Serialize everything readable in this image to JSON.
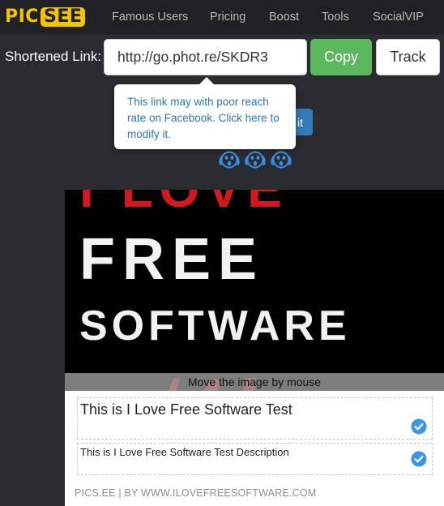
{
  "nav": {
    "logo_pic": "PIC",
    "logo_see": "SEE",
    "items": [
      {
        "label": "Famous Users"
      },
      {
        "label": "Pricing"
      },
      {
        "label": "Boost"
      },
      {
        "label": "Tools"
      },
      {
        "label": "SocialVIP"
      }
    ]
  },
  "shortener": {
    "label": "Shortened Link:",
    "url_value": "http://go.phot.re/SKDR3",
    "copy_label": "Copy",
    "track_label": "Track",
    "hidden_button_label": "it"
  },
  "tooltip": {
    "text": "This link may with poor reach rate on Facebook. Click here to modify it."
  },
  "emojis": [
    "scream-emoji-icon",
    "scream-emoji-icon",
    "scream-emoji-icon"
  ],
  "preview": {
    "image_line1": "I LOVE",
    "image_line2": "FREE",
    "image_line3": "SOFTWARE",
    "move_hint": "Move the image by mouse",
    "title_value": "This is I Love Free Software Test",
    "description_value": "This is I Love Free Software Test Description",
    "footer": "PICS.EE | BY WWW.ILOVEFREESOFTWARE.COM"
  },
  "colors": {
    "brand_yellow": "#f5c400",
    "copy_green": "#5cb85c",
    "link_blue": "#2a77b8",
    "check_blue": "#3a95e6",
    "image_red": "#d41820"
  }
}
